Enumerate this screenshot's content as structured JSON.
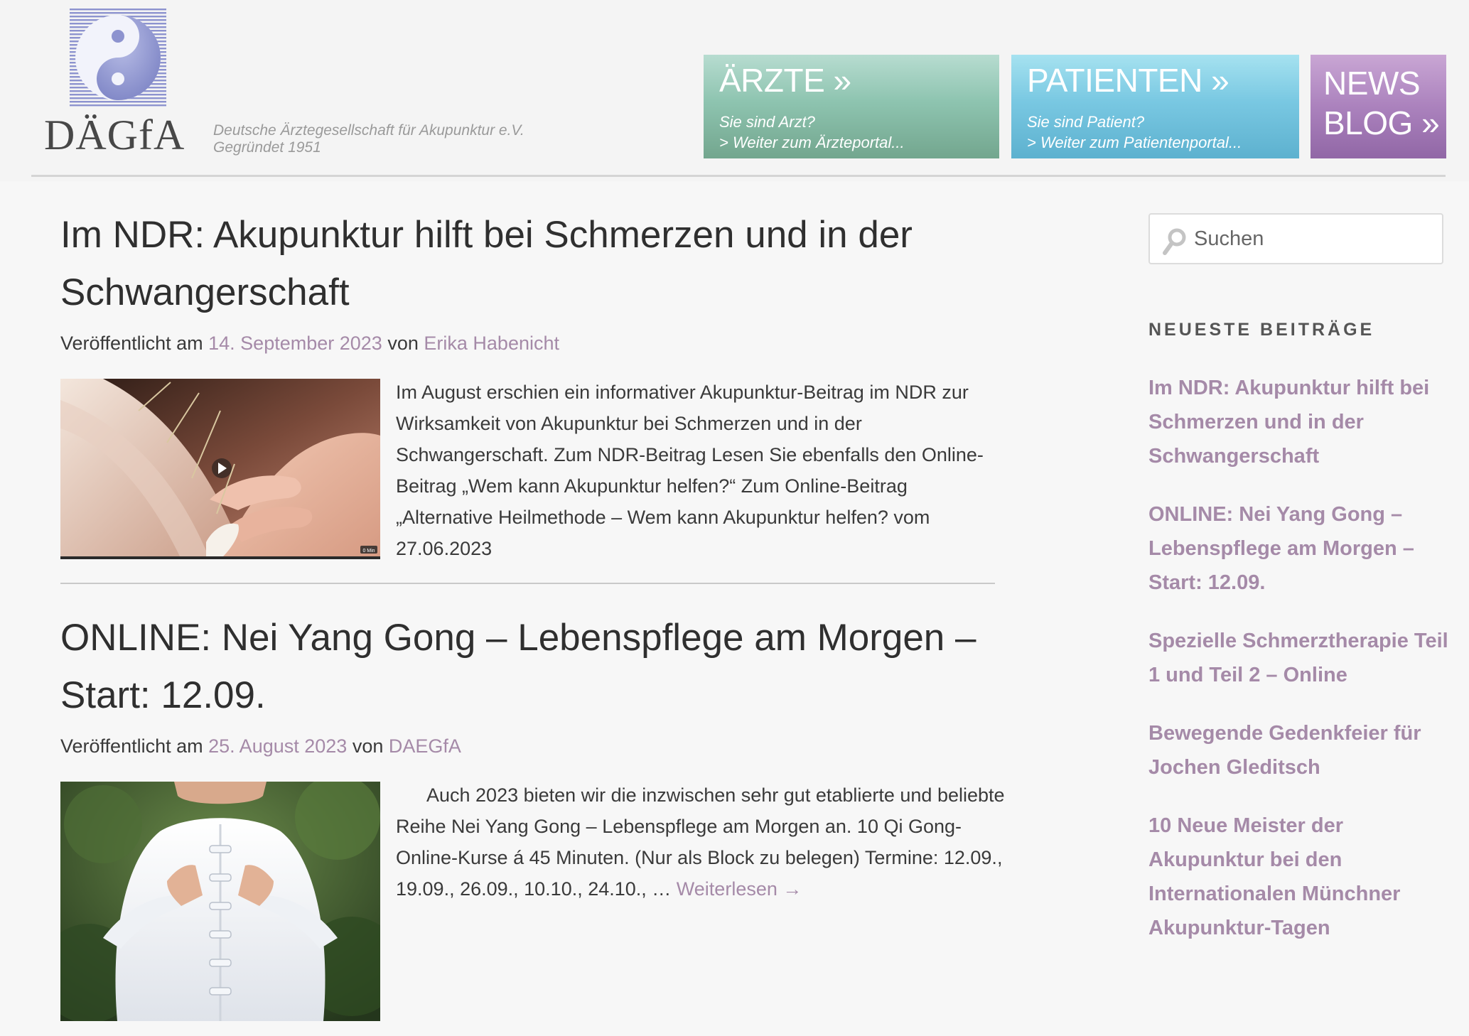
{
  "header": {
    "logo_text": "DÄGfA",
    "tagline_line1": "Deutsche Ärztegesellschaft für Akupunktur e.V.",
    "tagline_line2": "Gegründet 1951",
    "nav": [
      {
        "title": "ÄRZTE »",
        "subtitle_line1": "Sie sind Arzt?",
        "subtitle_line2": "> Weiter zum Ärzteportal...",
        "color": "#8ec4b0"
      },
      {
        "title": "PATIENTEN »",
        "subtitle_line1": "Sie sind Patient?",
        "subtitle_line2": "> Weiter zum Patientenportal...",
        "color": "#79c8e2"
      },
      {
        "title_line1": "NEWS",
        "title_line2": "BLOG »",
        "color": "#ab82bd"
      }
    ]
  },
  "articles": [
    {
      "title": "Im NDR: Akupunktur hilft bei Schmerzen und in der Schwangerschaft",
      "meta_prefix": "Veröffentlicht am",
      "date": "14. September 2023",
      "meta_by": "von",
      "author": "Erika Habenicht",
      "video_duration": "0 Min",
      "body": "Im August erschien ein informativer Akupunktur-Beitrag im NDR zur Wirksamkeit von Akupunktur bei Schmerzen und in der Schwangerschaft. Zum NDR-Beitrag Lesen Sie ebenfalls den Online-Beitrag „Wem kann Akupunktur helfen?“ Zum Online-Beitrag „Alternative Heilmethode – Wem kann Akupunktur helfen? vom 27.06.2023"
    },
    {
      "title": "ONLINE: Nei Yang Gong – Lebenspflege am Morgen – Start: 12.09.",
      "meta_prefix": "Veröffentlicht am",
      "date": "25. August 2023",
      "meta_by": "von",
      "author": "DAEGfA",
      "body": "Auch 2023 bieten wir die inzwischen sehr gut etablierte und beliebte Reihe Nei Yang Gong – Lebenspflege am Morgen an. 10 Qi Gong-Online-Kurse á 45 Minuten. (Nur als Block zu belegen) Termine: 12.09., 19.09., 26.09., 10.10., 24.10., …",
      "read_more": "Weiterlesen →"
    }
  ],
  "sidebar": {
    "search_placeholder": "Suchen",
    "recent_heading": "NEUESTE BEITRÄGE",
    "recent": [
      "Im NDR: Akupunktur hilft bei Schmerzen und in der Schwangerschaft",
      "ONLINE: Nei Yang Gong – Lebenspflege am Morgen – Start: 12.09.",
      "Spezielle Schmerztherapie Teil 1 und Teil 2 – Online",
      "Bewegende Gedenkfeier für Jochen Gleditsch",
      "10 Neue Meister der Akupunktur bei den Internationalen Münchner Akupunktur-Tagen"
    ]
  },
  "colors": {
    "link": "#a58aa8",
    "text": "#3a3a3a",
    "background": "#f7f7f7"
  }
}
